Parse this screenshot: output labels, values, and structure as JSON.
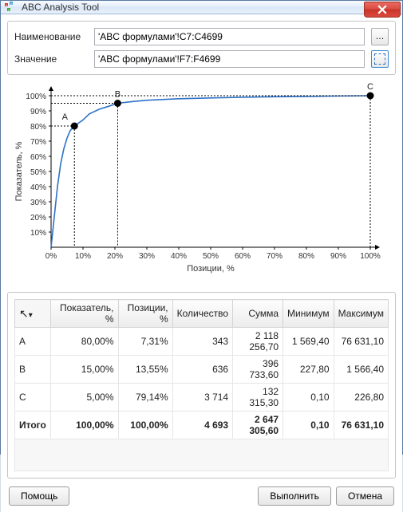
{
  "window_title": "ABC Analysis Tool",
  "fields": {
    "name_label": "Наименование",
    "name_value": "'ABC формулами'!C7:C4699",
    "value_label": "Значение",
    "value_value": "'ABC формулами'!F7:F4699"
  },
  "chart": {
    "xlabel": "Позиции, %",
    "ylabel": "Показатель, %",
    "points": {
      "A": {
        "label": "A"
      },
      "B": {
        "label": "B"
      },
      "C": {
        "label": "C"
      }
    }
  },
  "chart_data": {
    "type": "line",
    "title": "",
    "xlabel": "Позиции, %",
    "ylabel": "Показатель, %",
    "xlim": [
      0,
      100
    ],
    "ylim": [
      0,
      100
    ],
    "x": [
      0,
      1,
      2,
      3,
      4,
      5,
      6,
      7.31,
      10,
      12,
      15,
      18,
      20.86,
      25,
      30,
      40,
      50,
      60,
      70,
      80,
      90,
      100
    ],
    "values": [
      0,
      20,
      40,
      55,
      65,
      72,
      77,
      80,
      84,
      88,
      91,
      93,
      95,
      96,
      97,
      98,
      98.5,
      99,
      99.3,
      99.5,
      99.8,
      100
    ],
    "annotations": [
      {
        "label": "A",
        "x": 7.31,
        "y": 80
      },
      {
        "label": "B",
        "x": 20.86,
        "y": 95
      },
      {
        "label": "C",
        "x": 100,
        "y": 100
      }
    ],
    "xticks": [
      0,
      10,
      20,
      30,
      40,
      50,
      60,
      70,
      80,
      90,
      100
    ],
    "yticks": [
      10,
      20,
      30,
      40,
      50,
      60,
      70,
      80,
      90,
      100
    ]
  },
  "table": {
    "columns": [
      "",
      "Показатель, %",
      "Позиции, %",
      "Количество",
      "Сумма",
      "Минимум",
      "Максимум"
    ],
    "rows": [
      {
        "label": "A",
        "indicator": "80,00%",
        "positions": "7,31%",
        "count": "343",
        "sum": "2 118 256,70",
        "min": "1 569,40",
        "max": "76 631,10"
      },
      {
        "label": "B",
        "indicator": "15,00%",
        "positions": "13,55%",
        "count": "636",
        "sum": "396 733,60",
        "min": "227,80",
        "max": "1 566,40"
      },
      {
        "label": "C",
        "indicator": "5,00%",
        "positions": "79,14%",
        "count": "3 714",
        "sum": "132 315,30",
        "min": "0,10",
        "max": "226,80"
      }
    ],
    "total": {
      "label": "Итого",
      "indicator": "100,00%",
      "positions": "100,00%",
      "count": "4 693",
      "sum": "2 647 305,60",
      "min": "0,10",
      "max": "76 631,10"
    }
  },
  "buttons": {
    "help": "Помощь",
    "execute": "Выполнить",
    "cancel": "Отмена"
  }
}
